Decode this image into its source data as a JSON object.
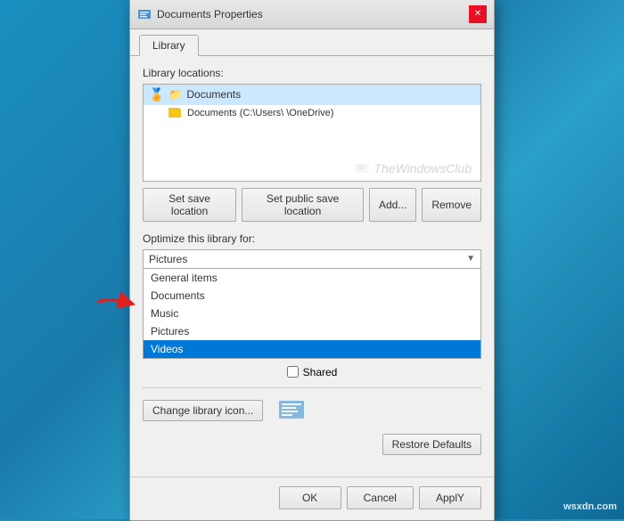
{
  "dialog": {
    "title": "Documents Properties",
    "close_label": "✕"
  },
  "tabs": [
    {
      "id": "library",
      "label": "Library",
      "active": true
    }
  ],
  "library_locations_label": "Library locations:",
  "library_items": [
    {
      "id": "documents-main",
      "name": "Documents",
      "type": "main",
      "selected": true
    },
    {
      "id": "documents-onedrive",
      "name": "Documents (C:\\Users\\      \\OneDrive)",
      "type": "folder",
      "selected": false
    }
  ],
  "watermark_text": "TheWindowsClub",
  "buttons": {
    "set_save_location": "Set save location",
    "set_public_save_location": "Set public save location",
    "add": "Add...",
    "remove": "Remove"
  },
  "optimize_label": "Optimize this library for:",
  "dropdown_value": "Pictures",
  "dropdown_options": [
    {
      "id": "general",
      "label": "General items",
      "selected": false
    },
    {
      "id": "documents",
      "label": "Documents",
      "selected": false
    },
    {
      "id": "music",
      "label": "Music",
      "selected": false
    },
    {
      "id": "pictures",
      "label": "Pictures",
      "selected": false
    },
    {
      "id": "videos",
      "label": "Videos",
      "selected": true
    }
  ],
  "checkbox": {
    "label": "Shared",
    "checked": false
  },
  "change_icon_btn": "Change library icon...",
  "restore_defaults_btn": "Restore Defaults",
  "ok_btn": "OK",
  "cancel_btn": "Cancel",
  "apply_btn": "ApplY",
  "wsxdn": "wsxdn.com"
}
